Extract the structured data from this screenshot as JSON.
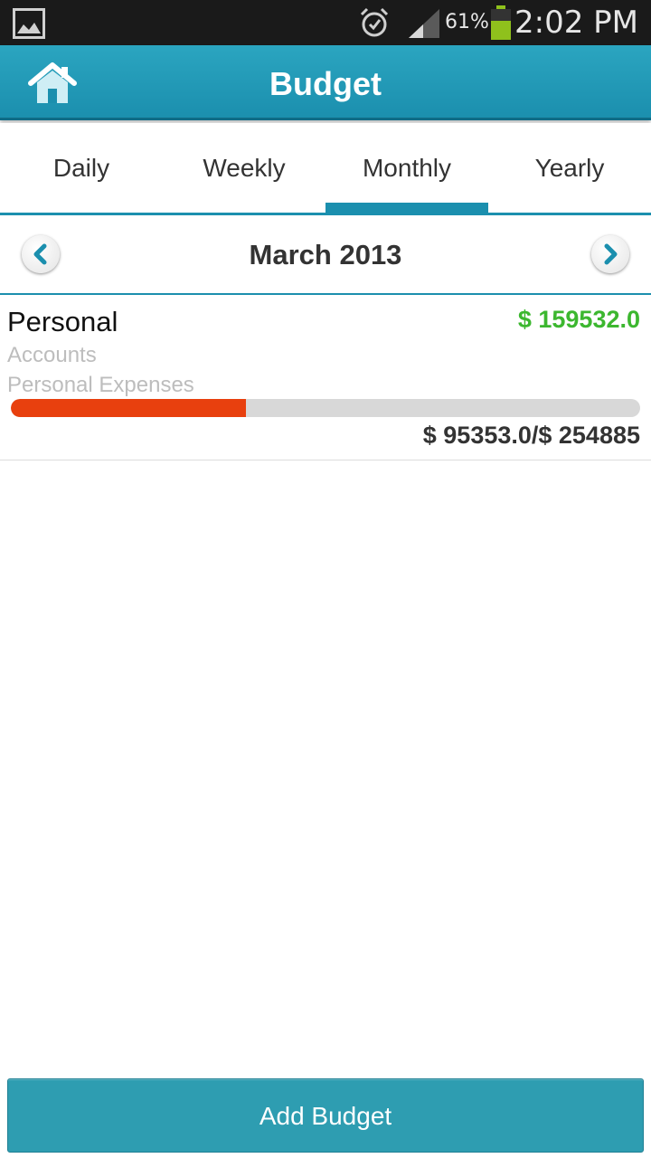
{
  "status_bar": {
    "battery_percent": "61%",
    "time": "2:02 PM",
    "battery_level": 0.61,
    "icons": [
      "gallery-icon",
      "alarm-icon",
      "signal-icon",
      "battery-icon"
    ]
  },
  "header": {
    "title": "Budget",
    "home_icon": "home-icon",
    "color": "#1b8fae"
  },
  "tabs": [
    {
      "label": "Daily",
      "active": false
    },
    {
      "label": "Weekly",
      "active": false
    },
    {
      "label": "Monthly",
      "active": true
    },
    {
      "label": "Yearly",
      "active": false
    }
  ],
  "period": {
    "label": "March 2013",
    "prev_icon": "chevron-left-icon",
    "next_icon": "chevron-right-icon"
  },
  "budgets": [
    {
      "name": "Personal",
      "remaining": "$ 159532.0",
      "account_label": "Accounts",
      "category": "Personal Expenses",
      "spent_vs_total": "$ 95353.0/$ 254885",
      "progress_fraction": 0.3741,
      "remaining_color": "#3cb72f",
      "progress_color": "#e8400e"
    }
  ],
  "footer": {
    "add_button_label": "Add Budget"
  }
}
